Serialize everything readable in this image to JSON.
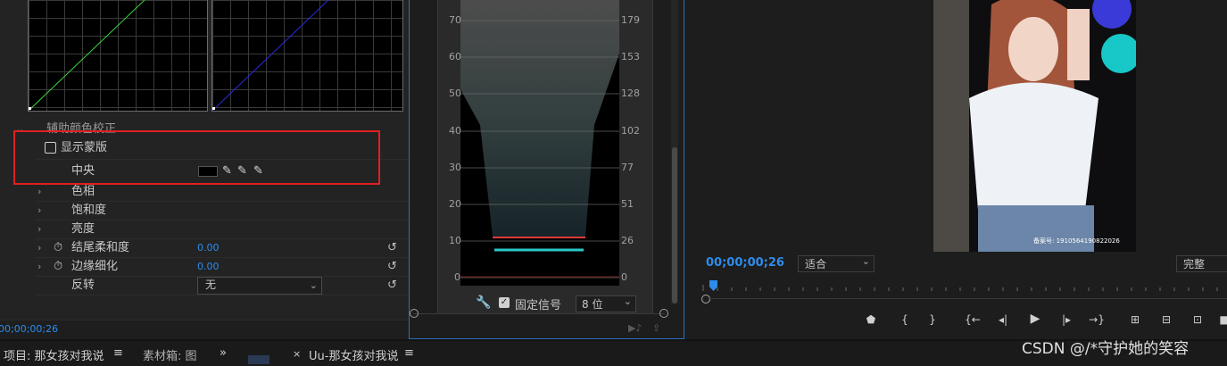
{
  "effects": {
    "section_title": "辅助颜色校正",
    "show_mask_label": "显示蒙版",
    "center_label": "中央",
    "hue_label": "色相",
    "saturation_label": "饱和度",
    "brightness_label": "亮度",
    "end_softness_label": "结尾柔和度",
    "end_softness_value": "0.00",
    "edge_thin_label": "边缘细化",
    "edge_thin_value": "0.00",
    "invert_label": "反转",
    "invert_value": "无",
    "timecode": "00;00;00;26",
    "highlight_color": "#e02020"
  },
  "scope": {
    "left_axis": [
      "70",
      "60",
      "50",
      "40",
      "30",
      "20",
      "10",
      "0"
    ],
    "right_axis": [
      "179",
      "153",
      "128",
      "102",
      "77",
      "51",
      "26",
      "0"
    ],
    "fixed_signal_label": "固定信号",
    "bit_depth": "8 位"
  },
  "program": {
    "timecode": "00;00;00;26",
    "fit": "适合",
    "quality": "完整",
    "watermark": "备案号: 1910564190822026",
    "accent": "#2d8ceb"
  },
  "tabs": {
    "project": "项目: 那女孩对我说",
    "bin": "素材箱: 图",
    "sequence": "Uu-那女孩对我说"
  },
  "credit": "CSDN @/*守护她的笑容"
}
